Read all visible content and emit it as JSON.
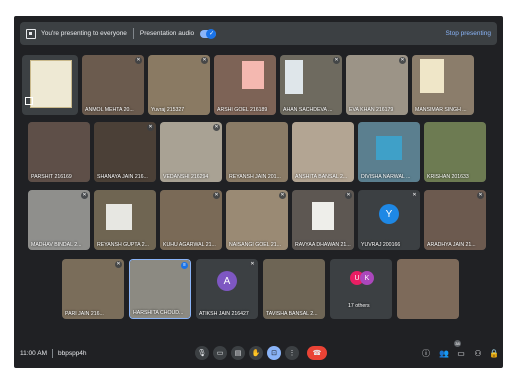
{
  "banner": {
    "presenting_text": "You're presenting to everyone",
    "audio_label": "Presentation audio",
    "stop_label": "Stop presenting"
  },
  "tiles": [
    {
      "name": "",
      "bg": "#d8d2bf"
    },
    {
      "name": "ANMOL MEHTA 20...",
      "bg": "#6b5b4e"
    },
    {
      "name": "Yuvraj 215327",
      "bg": "#8a7a63"
    },
    {
      "name": "ARSHI GOEL 216189",
      "bg": "#7d6356"
    },
    {
      "name": "AHAN SACHDEVA ...",
      "bg": "#6e6a5f"
    },
    {
      "name": "EVA KHAN 216179",
      "bg": "#9c9487"
    },
    {
      "name": "MANSIMAR SINGH ...",
      "bg": "#8b7d6b"
    },
    {
      "name": "PARSHIT 216169",
      "bg": "#5e4f48"
    },
    {
      "name": "SHANAYA JAIN 216...",
      "bg": "#4b4037"
    },
    {
      "name": "VEDANSHI 216294",
      "bg": "#a9a294"
    },
    {
      "name": "REYANSH JAIN 201...",
      "bg": "#8a7b66"
    },
    {
      "name": "ANSHITA BANSAL 2...",
      "bg": "#b3a593"
    },
    {
      "name": "DIVISHA NARWAL ...",
      "bg": "#5b7f8f"
    },
    {
      "name": "KRISHAN 201633",
      "bg": "#6d7b52"
    },
    {
      "name": "MADHAV BINDAL 2...",
      "bg": "#8f8f8c"
    },
    {
      "name": "REYANSH GUPTA 2...",
      "bg": "#6f6552"
    },
    {
      "name": "KUHU AGARWAL 21...",
      "bg": "#7a6a57"
    },
    {
      "name": "NAISANGI GOEL 21...",
      "bg": "#9a8a74"
    },
    {
      "name": "RAVYAA DHAWAN 21...",
      "bg": "#5d5752"
    },
    {
      "name": "YUVRAJ 200166",
      "bg": "#3c4043"
    },
    {
      "name": "ARADHYA JAIN 21...",
      "bg": "#6c5a4f"
    },
    {
      "name": "PARI JAIN 216...",
      "bg": "#7a6d5a"
    },
    {
      "name": "HARSHITA CHOUD...",
      "bg": "#8c8a82"
    },
    {
      "name": "ATIKSH JAIN 216427",
      "bg": "#3c4043"
    },
    {
      "name": "TAVISHA BANSAL 2...",
      "bg": "#6e6555"
    },
    {
      "name": "17 others",
      "bg": "#3c4043"
    },
    {
      "name": "",
      "bg": "#7d6a5a"
    }
  ],
  "avatars": {
    "yuvraj": "Y",
    "atiksh": "A",
    "others_u": "U",
    "others_k": "K"
  },
  "bottom": {
    "time": "11:00 AM",
    "meeting_code": "bbpspp4h",
    "people_count": "38"
  },
  "colors": {
    "accent": "#8ab4f8",
    "end_call": "#ea4335",
    "frame": "#202124",
    "tile": "#3c4043"
  }
}
